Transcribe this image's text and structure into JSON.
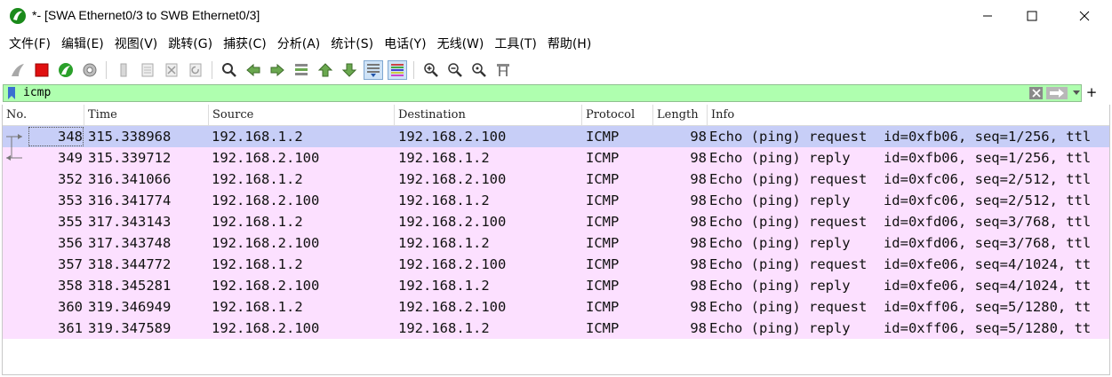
{
  "window": {
    "title": "*- [SWA Ethernet0/3 to SWB Ethernet0/3]",
    "minimize_label": "minimize",
    "maximize_label": "maximize",
    "close_label": "close"
  },
  "menu": [
    "文件(F)",
    "编辑(E)",
    "视图(V)",
    "跳转(G)",
    "捕获(C)",
    "分析(A)",
    "统计(S)",
    "电话(Y)",
    "无线(W)",
    "工具(T)",
    "帮助(H)"
  ],
  "toolbar": {
    "icons": [
      "shark-fin-start-icon",
      "stop-capture-icon",
      "restart-capture-icon",
      "capture-options-icon",
      "open-file-icon",
      "save-file-icon",
      "close-file-icon",
      "reload-file-icon",
      "find-packet-icon",
      "go-back-icon",
      "go-forward-icon",
      "go-to-packet-icon",
      "go-first-icon",
      "go-last-icon",
      "autoscroll-icon",
      "colorize-icon",
      "zoom-in-icon",
      "zoom-out-icon",
      "normal-size-icon",
      "resize-columns-icon"
    ]
  },
  "filter": {
    "value": "icmp",
    "add_label": "+"
  },
  "columns": [
    "No.",
    "Time",
    "Source",
    "Destination",
    "Protocol",
    "Length",
    "Info"
  ],
  "packets": [
    {
      "no": "348",
      "time": "315.338968",
      "src": "192.168.1.2",
      "dst": "192.168.2.100",
      "proto": "ICMP",
      "len": "98",
      "info": "Echo (ping) request  id=0xfb06, seq=1/256, ttl"
    },
    {
      "no": "349",
      "time": "315.339712",
      "src": "192.168.2.100",
      "dst": "192.168.1.2",
      "proto": "ICMP",
      "len": "98",
      "info": "Echo (ping) reply    id=0xfb06, seq=1/256, ttl"
    },
    {
      "no": "352",
      "time": "316.341066",
      "src": "192.168.1.2",
      "dst": "192.168.2.100",
      "proto": "ICMP",
      "len": "98",
      "info": "Echo (ping) request  id=0xfc06, seq=2/512, ttl"
    },
    {
      "no": "353",
      "time": "316.341774",
      "src": "192.168.2.100",
      "dst": "192.168.1.2",
      "proto": "ICMP",
      "len": "98",
      "info": "Echo (ping) reply    id=0xfc06, seq=2/512, ttl"
    },
    {
      "no": "355",
      "time": "317.343143",
      "src": "192.168.1.2",
      "dst": "192.168.2.100",
      "proto": "ICMP",
      "len": "98",
      "info": "Echo (ping) request  id=0xfd06, seq=3/768, ttl"
    },
    {
      "no": "356",
      "time": "317.343748",
      "src": "192.168.2.100",
      "dst": "192.168.1.2",
      "proto": "ICMP",
      "len": "98",
      "info": "Echo (ping) reply    id=0xfd06, seq=3/768, ttl"
    },
    {
      "no": "357",
      "time": "318.344772",
      "src": "192.168.1.2",
      "dst": "192.168.2.100",
      "proto": "ICMP",
      "len": "98",
      "info": "Echo (ping) request  id=0xfe06, seq=4/1024, tt"
    },
    {
      "no": "358",
      "time": "318.345281",
      "src": "192.168.2.100",
      "dst": "192.168.1.2",
      "proto": "ICMP",
      "len": "98",
      "info": "Echo (ping) reply    id=0xfe06, seq=4/1024, tt"
    },
    {
      "no": "360",
      "time": "319.346949",
      "src": "192.168.1.2",
      "dst": "192.168.2.100",
      "proto": "ICMP",
      "len": "98",
      "info": "Echo (ping) request  id=0xff06, seq=5/1280, tt"
    },
    {
      "no": "361",
      "time": "319.347589",
      "src": "192.168.2.100",
      "dst": "192.168.1.2",
      "proto": "ICMP",
      "len": "98",
      "info": "Echo (ping) reply    id=0xff06, seq=5/1280, tt"
    }
  ],
  "selected_packet": "348",
  "colors": {
    "row_icmp": "#fce0ff",
    "row_selected": "#c7cef7",
    "filter_valid": "#afffaf",
    "stop_red": "#e01010",
    "shark_green": "#2aa02a"
  }
}
